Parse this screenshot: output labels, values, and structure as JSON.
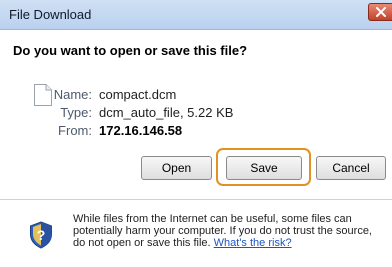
{
  "window": {
    "title": "File Download",
    "close_icon": "close-icon"
  },
  "dialog": {
    "question": "Do you want to open or save this file?",
    "file_icon": "blank-file-icon",
    "fields": [
      {
        "label": "Name:",
        "value": "compact.dcm"
      },
      {
        "label": "Type:",
        "value": "dcm_auto_file, 5.22 KB"
      },
      {
        "label": "From:",
        "value": "172.16.146.58"
      }
    ],
    "buttons": {
      "open": "Open",
      "save": "Save",
      "cancel": "Cancel"
    },
    "highlight_color": "#e09222"
  },
  "warning": {
    "icon": "security-shield-question-icon",
    "text": "While files from the Internet can be useful, some files can potentially harm your computer. If you do not trust the source, do not open or save this file.",
    "link": "What's the risk?"
  }
}
